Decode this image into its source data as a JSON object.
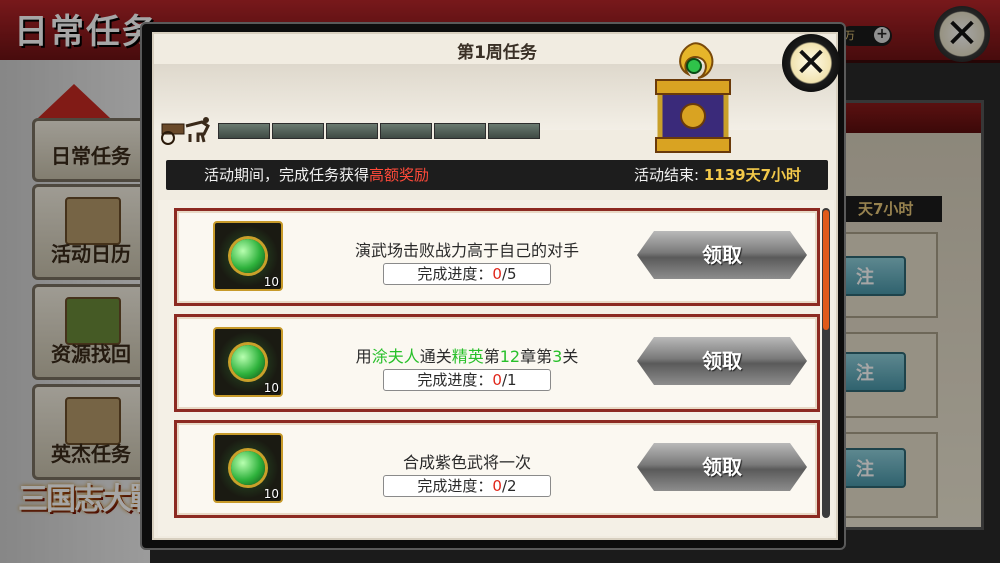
{
  "background": {
    "title": "日常任务",
    "currency_label": "万",
    "sidebar_items": [
      {
        "label": "日常任务"
      },
      {
        "label": "活动日历"
      },
      {
        "label": "资源找回"
      },
      {
        "label": "英杰任务"
      }
    ],
    "logo_text": "三国志大戰",
    "right_end_time": "天7小时",
    "right_button_label": "注"
  },
  "modal": {
    "title": "第1周任务",
    "weekly_progress": {
      "completed_segments": 0,
      "total_segments": 6
    },
    "info": {
      "period_text": "活动期间，完成任务获得",
      "reward_highlight": "高额奖励",
      "end_label": "活动结束:",
      "end_value": "1139天7小时"
    },
    "tasks": [
      {
        "desc_parts": [
          "演武场击败战力高于自己的对手"
        ],
        "icon": "jade-orb-icon",
        "item_count": "10",
        "progress_label": "完成进度：",
        "progress_current": "0",
        "progress_total": "/5",
        "button_label": "领取"
      },
      {
        "desc_prefix": "用",
        "desc_g1": "涂夫人",
        "desc_mid1": "通关",
        "desc_g2": "精英",
        "desc_mid2": "第",
        "desc_g3": "12",
        "desc_mid3": "章第",
        "desc_g4": "3",
        "desc_suffix": "关",
        "icon": "jade-orb-icon",
        "item_count": "10",
        "progress_label": "完成进度：",
        "progress_current": "0",
        "progress_total": "/1",
        "button_label": "领取"
      },
      {
        "desc_parts": [
          "合成紫色武将一次"
        ],
        "icon": "jade-orb-icon",
        "item_count": "10",
        "progress_label": "完成进度：",
        "progress_current": "0",
        "progress_total": "/2",
        "button_label": "领取"
      }
    ]
  },
  "colors": {
    "accent_red": "#8c2a22",
    "highlight_red": "#ff4a3a",
    "highlight_green": "#28c02a",
    "gold": "#f3c94a"
  }
}
